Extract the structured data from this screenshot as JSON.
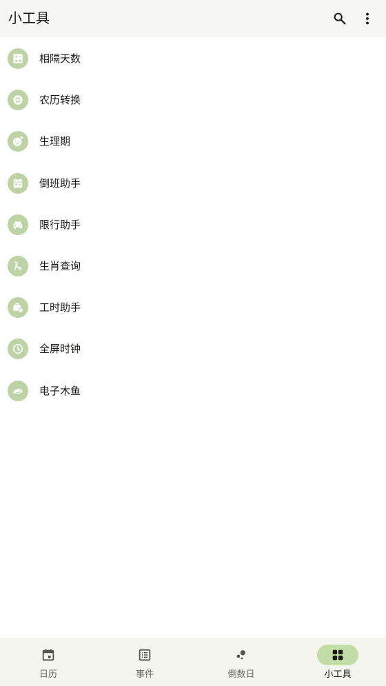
{
  "appbar": {
    "title": "小工具",
    "search_icon": "search-icon",
    "more_icon": "more-vert-icon"
  },
  "tools": [
    {
      "label": "相隔天数",
      "icon": "calculator-icon"
    },
    {
      "label": "农历转换",
      "icon": "convert-cycle-icon"
    },
    {
      "label": "生理期",
      "icon": "period-face-icon"
    },
    {
      "label": "倒班助手",
      "icon": "shift-calendar-icon"
    },
    {
      "label": "限行助手",
      "icon": "car-icon"
    },
    {
      "label": "生肖查询",
      "icon": "zodiac-icon"
    },
    {
      "label": "工时助手",
      "icon": "work-hours-icon"
    },
    {
      "label": "全屏时钟",
      "icon": "clock-icon"
    },
    {
      "label": "电子木鱼",
      "icon": "wooden-fish-icon"
    }
  ],
  "bottom_nav": [
    {
      "label": "日历",
      "icon": "calendar-icon",
      "active": false
    },
    {
      "label": "事件",
      "icon": "event-list-icon",
      "active": false
    },
    {
      "label": "倒数日",
      "icon": "countdown-dots-icon",
      "active": false
    },
    {
      "label": "小工具",
      "icon": "grid-apps-icon",
      "active": true
    }
  ],
  "colors": {
    "accent": "#c2dda6",
    "icon_circle": "#bdd3a6",
    "icon_glyph": "#ffffff",
    "appbar_bg": "#f7f8f3",
    "nav_bg": "#f3f5ee"
  }
}
